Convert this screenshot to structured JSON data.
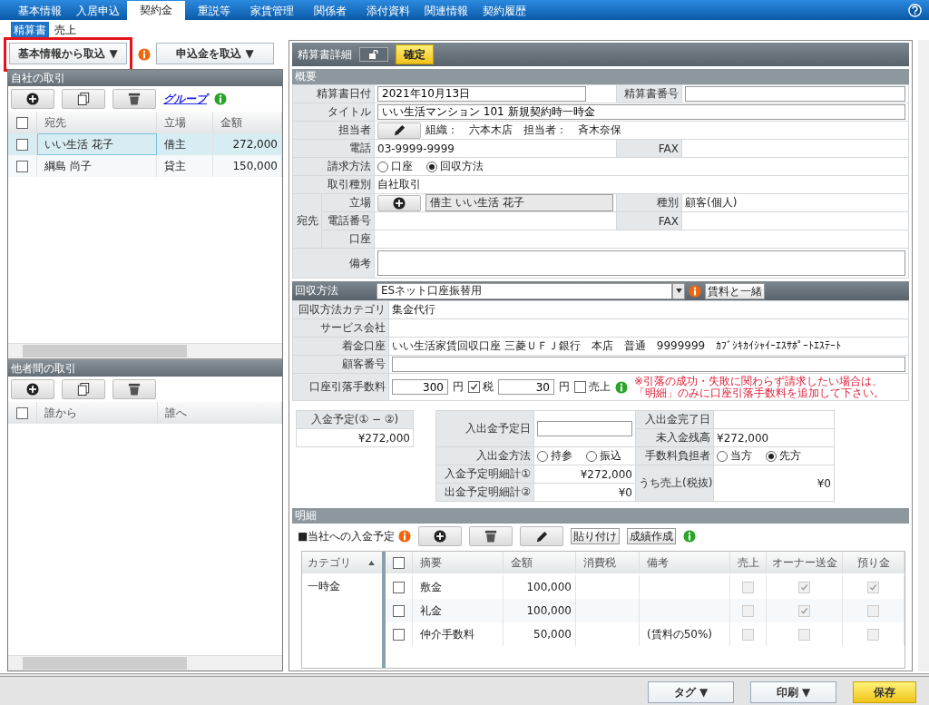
{
  "tabs": [
    {
      "label": "基本情報",
      "selected": false
    },
    {
      "label": "入居申込",
      "selected": false
    },
    {
      "label": "契約金",
      "selected": true
    },
    {
      "label": "重説等",
      "selected": false
    },
    {
      "label": "家賃管理",
      "selected": false
    },
    {
      "label": "関係者",
      "selected": false
    },
    {
      "label": "添付資料",
      "selected": false
    },
    {
      "label": "関連情報",
      "selected": false
    },
    {
      "label": "契約履歴",
      "selected": false
    }
  ],
  "sub_tabs": [
    {
      "label": "精算書",
      "selected": true
    },
    {
      "label": "売上",
      "selected": false
    }
  ],
  "left_panel": {
    "import_buttons": [
      {
        "label": "基本情報から取込 ▼",
        "highlighted": true
      },
      {
        "label": "申込金を取込 ▼",
        "highlighted": false
      }
    ],
    "own_transactions": {
      "title": "自社の取引",
      "link": "グループ",
      "header_checked": false,
      "columns": [
        "宛先",
        "立場",
        "金額"
      ],
      "rows": [
        {
          "checked": false,
          "selected": true,
          "cells": [
            "いい生活 花子",
            "借主",
            "272,000"
          ]
        },
        {
          "checked": false,
          "selected": false,
          "cells": [
            "綱島 尚子",
            "貸主",
            "150,000"
          ]
        }
      ]
    },
    "other_transactions": {
      "title": "他者間の取引",
      "header_checked": false,
      "columns": [
        "誰から",
        "誰へ"
      ]
    }
  },
  "detail": {
    "title": "精算書詳細",
    "locked": false,
    "confirm_button": "確定",
    "overview": {
      "title": "概要",
      "date_label": "精算書日付",
      "date": "2021年10月13日",
      "number_label": "精算書番号",
      "title_label": "タイトル",
      "title_value": "いい生活マンション 101 新規契約時一時金",
      "staff_label": "担当者",
      "staff_text": "組織：　六本木店　担当者：　斉木奈保",
      "phone_label": "電話",
      "phone": "03-9999-9999",
      "fax_label": "FAX",
      "billing_label": "請求方法",
      "billing_options": [
        {
          "label": "口座",
          "selected": false
        },
        {
          "label": "回収方法",
          "selected": true
        }
      ],
      "type_label": "取引種別",
      "type": "自社取引",
      "recipient_label": "宛先",
      "position_label": "立場",
      "position": "借主 いい生活 花子",
      "kind_label": "種別",
      "kind_value": "顧客(個人)",
      "tel_label": "電話番号",
      "fax2_label": "FAX",
      "account_label": "口座",
      "note_label": "備考"
    },
    "collection": {
      "title": "回収方法",
      "method": "ESネット口座振替用",
      "with_rent_button": "賃料と一緒",
      "category_label": "回収方法カテゴリ",
      "category": "集金代行",
      "service_label": "サービス会社",
      "account_label": "着金口座",
      "account": "いい生活家賃回収口座 三菱ＵＦＪ銀行　本店　普通　9999999　ｶﾌﾞｼｷｶｲｼｬｲｰｴｽｻﾎﾟｰﾄｴｽﾃｰﾄ",
      "customer_no_label": "顧客番号",
      "fee_label": "口座引落手数料",
      "fee": "300",
      "fee_unit": "円",
      "tax_checked": true,
      "tax_label": "税",
      "tax": "30",
      "tax_unit": "円",
      "sales_checked": false,
      "sales_label": "売上",
      "notice_lines": [
        "※引落の成功・失敗に関わらず請求したい場合は、",
        "「明細」のみに口座引落手数料を追加して下さい。"
      ]
    },
    "summary": {
      "expected_label": "入金予定(① − ②)",
      "expected": "¥272,000",
      "scheduled_date_label": "入出金予定日",
      "done_date_label": "入出金完了日",
      "unpaid_label": "未入金残高",
      "unpaid": "¥272,000",
      "method_label": "入出金方法",
      "methods": [
        {
          "label": "持参",
          "selected": false
        },
        {
          "label": "振込",
          "selected": false
        }
      ],
      "fee_payer_label": "手数料負担者",
      "fee_payers": [
        {
          "label": "当方",
          "selected": false
        },
        {
          "label": "先方",
          "selected": true
        }
      ],
      "in_total_label": "入金予定明細計①",
      "in_total": "¥272,000",
      "out_total_label": "出金予定明細計②",
      "out_total": "¥0",
      "sales_label": "うち売上(税抜)",
      "sales": "¥0"
    },
    "details": {
      "title": "明細",
      "subtitle": "■当社への入金予定",
      "paste_button": "貼り付け",
      "create_button": "成績作成",
      "category_header": "カテゴリ",
      "categories": [
        "一時金"
      ],
      "header_checked": false,
      "columns": [
        "摘要",
        "金額",
        "消費税",
        "備考",
        "売上",
        "オーナー送金",
        "預り金"
      ],
      "rows": [
        {
          "checked": false,
          "summary": "敷金",
          "amount": "100,000",
          "sales": false,
          "owner": true,
          "deposit": true
        },
        {
          "checked": false,
          "summary": "礼金",
          "amount": "100,000",
          "sales": false,
          "owner": true,
          "deposit": false
        },
        {
          "checked": false,
          "summary": "仲介手数料",
          "amount": "50,000",
          "note": "(賃料の50%)",
          "sales": false,
          "owner": false,
          "deposit": false
        }
      ]
    }
  },
  "footer_buttons": [
    {
      "label": "タグ ▼",
      "kind": "plain"
    },
    {
      "label": "印刷 ▼",
      "kind": "plain"
    },
    {
      "label": "保存",
      "kind": "primary"
    }
  ]
}
